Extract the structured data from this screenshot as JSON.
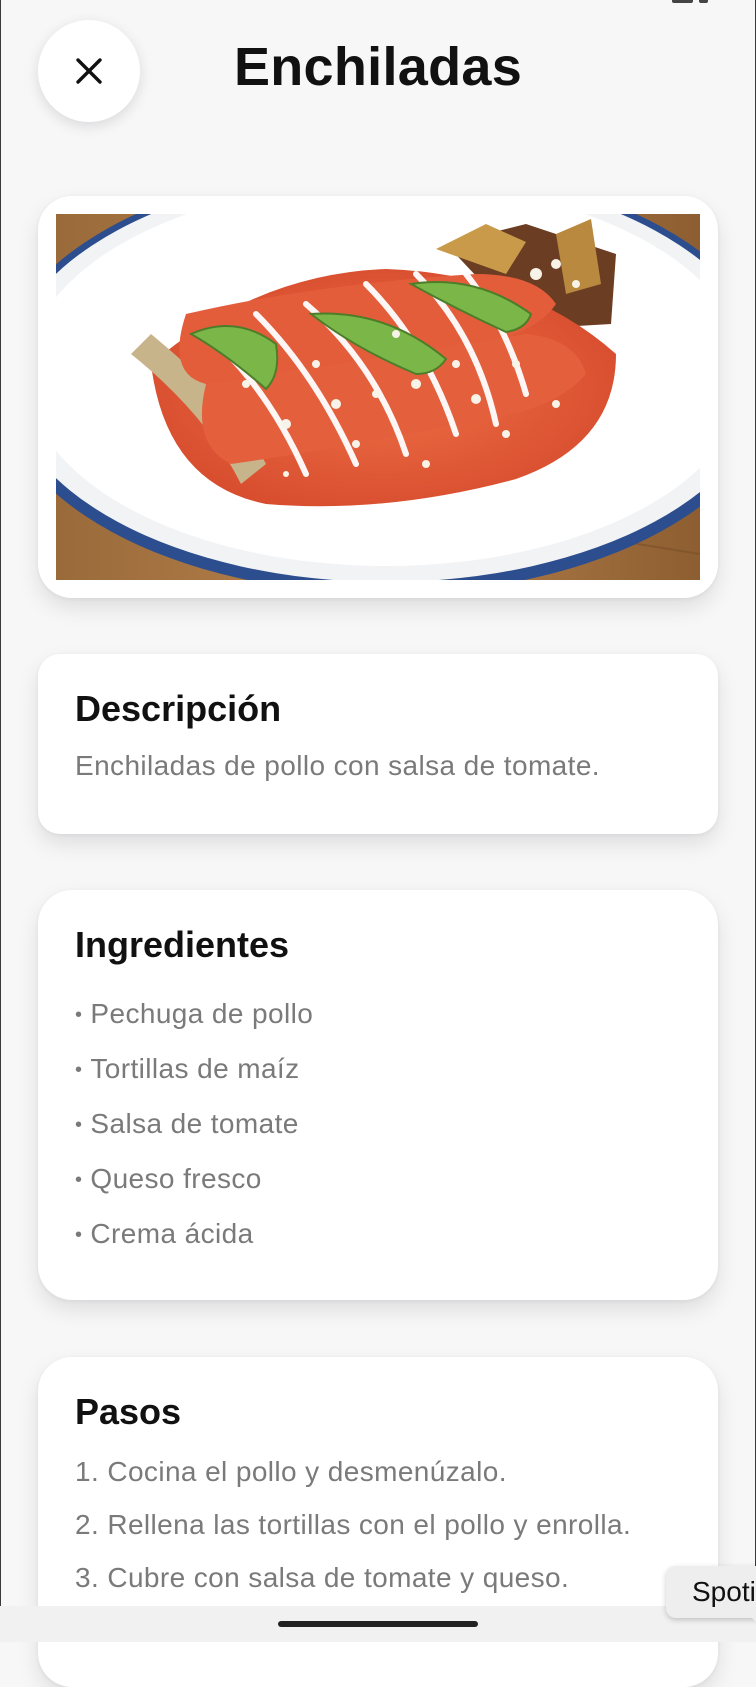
{
  "header": {
    "title": "Enchiladas",
    "close_icon": "close-icon"
  },
  "image": {
    "alt": "Enchiladas"
  },
  "description": {
    "heading": "Descripción",
    "text": "Enchiladas de pollo con salsa de tomate."
  },
  "ingredients": {
    "heading": "Ingredientes",
    "items": [
      "Pechuga de pollo",
      "Tortillas de maíz",
      "Salsa de tomate",
      "Queso fresco",
      "Crema ácida"
    ]
  },
  "steps": {
    "heading": "Pasos",
    "items": [
      "1. Cocina el pollo y desmenúzalo.",
      "2. Rellena las tortillas con el pollo y enrolla.",
      "3. Cubre con salsa de tomate y queso."
    ]
  },
  "toast": {
    "text": "Spoti"
  },
  "colors": {
    "background": "#f7f7f8",
    "card": "#ffffff",
    "secondary_text": "#7a7a7a",
    "plate_rim": "#2b4c8c",
    "sauce": "#e2573a",
    "avocado": "#7ab648"
  }
}
